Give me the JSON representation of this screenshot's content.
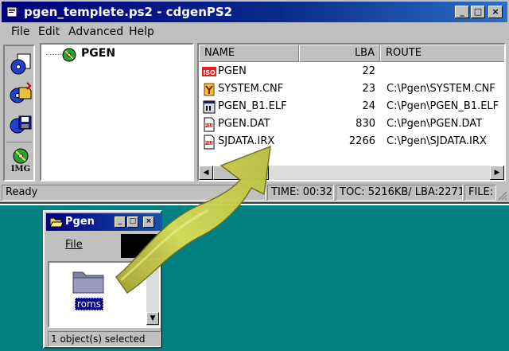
{
  "main_window": {
    "title": "pgen_templete.ps2 - cdgenPS2",
    "menu": [
      "File",
      "Edit",
      "Advanced",
      "Help"
    ],
    "tree_root": "PGEN",
    "columns": [
      "NAME",
      "LBA",
      "ROUTE"
    ],
    "files": [
      {
        "name": "PGEN",
        "lba": "22",
        "route": "",
        "icon": "iso-icon"
      },
      {
        "name": "SYSTEM.CNF",
        "lba": "23",
        "route": "C:\\Pgen\\SYSTEM.CNF",
        "icon": "config-icon"
      },
      {
        "name": "PGEN_B1.ELF",
        "lba": "24",
        "route": "C:\\Pgen\\PGEN_B1.ELF",
        "icon": "elf-icon"
      },
      {
        "name": "PGEN.DAT",
        "lba": "830",
        "route": "C:\\Pgen\\PGEN.DAT",
        "icon": "file-icon"
      },
      {
        "name": "SJDATA.IRX",
        "lba": "2266",
        "route": "C:\\Pgen\\SJDATA.IRX",
        "icon": "file-icon"
      }
    ],
    "status": {
      "ready": "Ready",
      "time": "TIME: 00:32",
      "toc": "TOC: 5216KB/ LBA:2271",
      "file": "FILE:"
    },
    "toolbar_img_label": "IMG"
  },
  "small_window": {
    "title": "Pgen",
    "menu_file": "File",
    "folder_name": "roms",
    "status": "1 object(s) selected"
  },
  "colors": {
    "desktop": "#008080",
    "title_active": "#000080",
    "arrow": "#c8cc3c"
  }
}
